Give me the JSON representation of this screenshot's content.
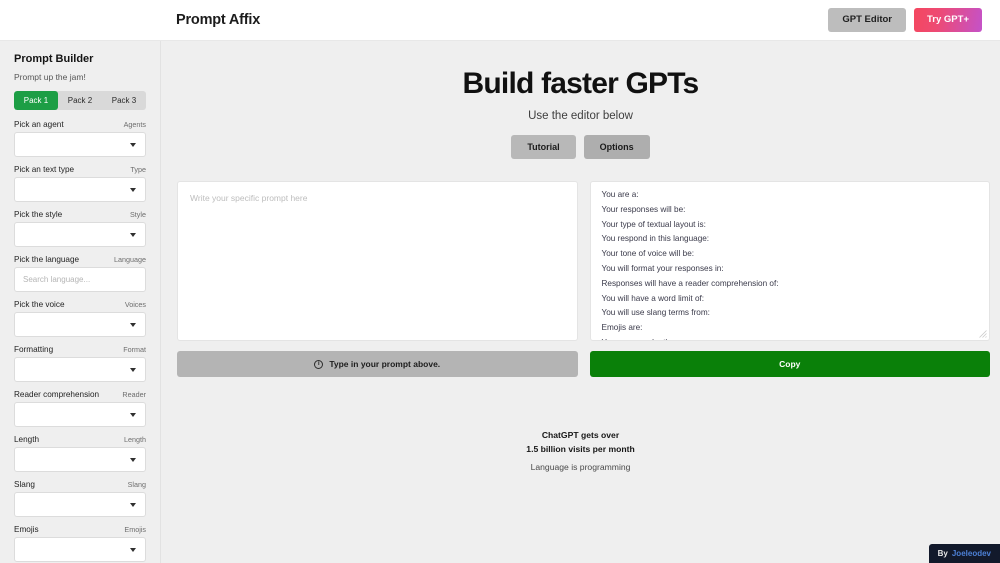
{
  "header": {
    "brand": "Prompt Affix",
    "gpt_editor_label": "GPT Editor",
    "try_gpt_label": "Try GPT+"
  },
  "sidebar": {
    "title": "Prompt Builder",
    "subtitle": "Prompt up the jam!",
    "packs": [
      {
        "label": "Pack 1",
        "active": true
      },
      {
        "label": "Pack 2",
        "active": false
      },
      {
        "label": "Pack 3",
        "active": false
      }
    ],
    "fields": [
      {
        "label": "Pick an agent",
        "hint": "Agents",
        "type": "select",
        "value": ""
      },
      {
        "label": "Pick an text type",
        "hint": "Type",
        "type": "select",
        "value": ""
      },
      {
        "label": "Pick the style",
        "hint": "Style",
        "type": "select",
        "value": ""
      },
      {
        "label": "Pick the language",
        "hint": "Language",
        "type": "search",
        "value": "",
        "placeholder": "Search language..."
      },
      {
        "label": "Pick the voice",
        "hint": "Voices",
        "type": "select",
        "value": ""
      },
      {
        "label": "Formatting",
        "hint": "Format",
        "type": "select",
        "value": ""
      },
      {
        "label": "Reader comprehension",
        "hint": "Reader",
        "type": "select",
        "value": ""
      },
      {
        "label": "Length",
        "hint": "Length",
        "type": "select",
        "value": ""
      },
      {
        "label": "Slang",
        "hint": "Slang",
        "type": "select",
        "value": ""
      },
      {
        "label": "Emojis",
        "hint": "Emojis",
        "type": "select",
        "value": ""
      }
    ]
  },
  "main": {
    "title": "Build faster GPTs",
    "subtitle": "Use the editor below",
    "tutorial_label": "Tutorial",
    "options_label": "Options",
    "prompt_placeholder": "Write your specific prompt here",
    "prompt_value": "",
    "output_lines": [
      "You are a:",
      "Your responses will be:",
      "Your type of textual layout is:",
      "You respond in this language:",
      "Your tone of voice will be:",
      "You will format your responses in:",
      "Responses will have a reader comprehension of:",
      "You will have a word limit of:",
      "You will use slang terms from:",
      "Emojis are:",
      "Your purpose by the user:"
    ],
    "disabled_button_label": "Type in your prompt above.",
    "copy_label": "Copy"
  },
  "stats": {
    "line1": "ChatGPT gets over",
    "line2": "1.5 billion visits per month",
    "line3": "Language is programming"
  },
  "credit": {
    "by": "By",
    "name": "Joeleodev"
  },
  "colors": {
    "accent_green": "#1d9e45",
    "copy_green": "#0a8009",
    "page_bg": "#efefef",
    "credit_bg": "#12192b",
    "credit_name": "#4d80d6"
  }
}
